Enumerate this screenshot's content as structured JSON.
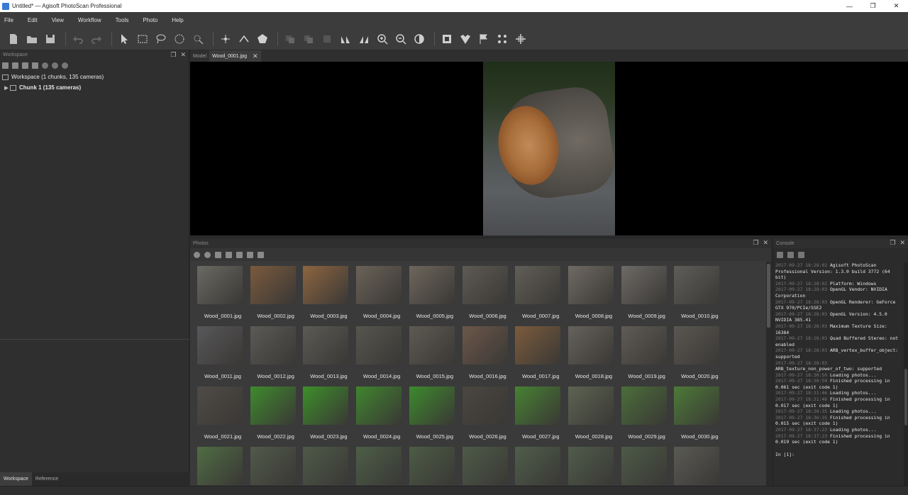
{
  "window": {
    "title": "Untitled* — Agisoft PhotoScan Professional",
    "buttons": {
      "minimize": "—",
      "maximize": "❐",
      "close": "✕"
    }
  },
  "menu": [
    "File",
    "Edit",
    "View",
    "Workflow",
    "Tools",
    "Photo",
    "Help"
  ],
  "workspace": {
    "header": "Workspace",
    "root": "Workspace (1 chunks, 135 cameras)",
    "chunk": "Chunk 1 (135 cameras)",
    "bottom_tabs": [
      "Workspace",
      "Reference"
    ]
  },
  "model_tabs": {
    "model": "Model",
    "photo": "Wood_0001.jpg"
  },
  "photos_pane": {
    "header": "Photos",
    "items": [
      {
        "name": "Wood_0001.jpg",
        "tone": "#6b6963"
      },
      {
        "name": "Wood_0002.jpg",
        "tone": "#7a5a3d"
      },
      {
        "name": "Wood_0003.jpg",
        "tone": "#8d6540"
      },
      {
        "name": "Wood_0004.jpg",
        "tone": "#6a6258"
      },
      {
        "name": "Wood_0005.jpg",
        "tone": "#6d665c"
      },
      {
        "name": "Wood_0006.jpg",
        "tone": "#5e5a55"
      },
      {
        "name": "Wood_0007.jpg",
        "tone": "#615e58"
      },
      {
        "name": "Wood_0008.jpg",
        "tone": "#6f6a63"
      },
      {
        "name": "Wood_0009.jpg",
        "tone": "#6d6a66"
      },
      {
        "name": "Wood_0010.jpg",
        "tone": "#5f5d59"
      },
      {
        "name": "Wood_0011.jpg",
        "tone": "#58575a"
      },
      {
        "name": "Wood_0012.jpg",
        "tone": "#5c5a57"
      },
      {
        "name": "Wood_0013.jpg",
        "tone": "#5b5a55"
      },
      {
        "name": "Wood_0014.jpg",
        "tone": "#57554f"
      },
      {
        "name": "Wood_0015.jpg",
        "tone": "#5e5a53"
      },
      {
        "name": "Wood_0016.jpg",
        "tone": "#6b574a"
      },
      {
        "name": "Wood_0017.jpg",
        "tone": "#7c5c3c"
      },
      {
        "name": "Wood_0018.jpg",
        "tone": "#66625c"
      },
      {
        "name": "Wood_0019.jpg",
        "tone": "#5f5b56"
      },
      {
        "name": "Wood_0020.jpg",
        "tone": "#5a5752"
      },
      {
        "name": "Wood_0021.jpg",
        "tone": "#4f4b46"
      },
      {
        "name": "Wood_0022.jpg",
        "tone": "#3f8a2e"
      },
      {
        "name": "Wood_0023.jpg",
        "tone": "#3c8f2a"
      },
      {
        "name": "Wood_0024.jpg",
        "tone": "#3f852e"
      },
      {
        "name": "Wood_0025.jpg",
        "tone": "#3d8a2d"
      },
      {
        "name": "Wood_0026.jpg",
        "tone": "#4a4640"
      },
      {
        "name": "Wood_0027.jpg",
        "tone": "#478232"
      },
      {
        "name": "Wood_0028.jpg",
        "tone": "#5d6452"
      },
      {
        "name": "Wood_0029.jpg",
        "tone": "#4b6e3a"
      },
      {
        "name": "Wood_0030.jpg",
        "tone": "#4d7a38"
      },
      {
        "name": "",
        "tone": "#4f6d44"
      },
      {
        "name": "",
        "tone": "#515a4a"
      },
      {
        "name": "",
        "tone": "#4e5a48"
      },
      {
        "name": "",
        "tone": "#4d5e47"
      },
      {
        "name": "",
        "tone": "#4c5c45"
      },
      {
        "name": "",
        "tone": "#4e5b48"
      },
      {
        "name": "",
        "tone": "#4f5e4a"
      },
      {
        "name": "",
        "tone": "#505c4b"
      },
      {
        "name": "",
        "tone": "#4d5a47"
      },
      {
        "name": "",
        "tone": "#5a5a55"
      }
    ]
  },
  "console": {
    "header": "Console",
    "lines": [
      {
        "ts": "2017-09-27 18:28:02",
        "text": " Agisoft PhotoScan Professional Version: 1.3.0 build 3772 (64 bit)"
      },
      {
        "ts": "2017-09-27 18:28:02",
        "text": " Platform: Windows"
      },
      {
        "ts": "2017-09-27 18:28:03",
        "text": " OpenGL Vendor: NVIDIA Corporation"
      },
      {
        "ts": "2017-09-27 18:28:03",
        "text": " OpenGL Renderer: GeForce GTX 970/PCIe/SSE2"
      },
      {
        "ts": "2017-09-27 18:28:03",
        "text": " OpenGL Version: 4.5.0 NVIDIA 385.41"
      },
      {
        "ts": "2017-09-27 18:28:03",
        "text": " Maximum Texture Size: 16384"
      },
      {
        "ts": "2017-09-27 18:28:03",
        "text": " Quad Buffered Stereo: not enabled"
      },
      {
        "ts": "2017-09-27 18:28:03",
        "text": " ARB_vertex_buffer_object: supported"
      },
      {
        "ts": "2017-09-27 18:28:03",
        "text": " ARB_texture_non_power_of_two: supported"
      },
      {
        "ts": "2017-09-27 18:30:50",
        "text": " Loading photos..."
      },
      {
        "ts": "2017-09-27 18:30:50",
        "text": " Finished processing in 0.061 sec (exit code 1)"
      },
      {
        "ts": "2017-09-27 18:31:46",
        "text": " Loading photos..."
      },
      {
        "ts": "2017-09-27 18:31:46",
        "text": " Finished processing in 0.017 sec (exit code 1)"
      },
      {
        "ts": "2017-09-27 18:36:35",
        "text": " Loading photos..."
      },
      {
        "ts": "2017-09-27 18:36:35",
        "text": " Finished processing in 0.015 sec (exit code 1)"
      },
      {
        "ts": "2017-09-27 18:37:23",
        "text": " Loading photos..."
      },
      {
        "ts": "2017-09-27 18:37:23",
        "text": " Finished processing in 0.019 sec (exit code 1)"
      }
    ],
    "prompt": "In [1]:"
  },
  "icons": {
    "toolbar": [
      "new-icon",
      "open-icon",
      "save-icon",
      "undo-icon",
      "redo-icon",
      "select-icon",
      "rect-select-icon",
      "lasso-icon",
      "circle-select-icon",
      "magic-wand-icon",
      "point-icon",
      "ruler-icon",
      "polygon-icon",
      "zoom-in-icon",
      "zoom-out-icon",
      "contrast-icon",
      "mask-icon",
      "shape-icon",
      "flag-icon",
      "dots-icon",
      "navigate-icon"
    ]
  }
}
